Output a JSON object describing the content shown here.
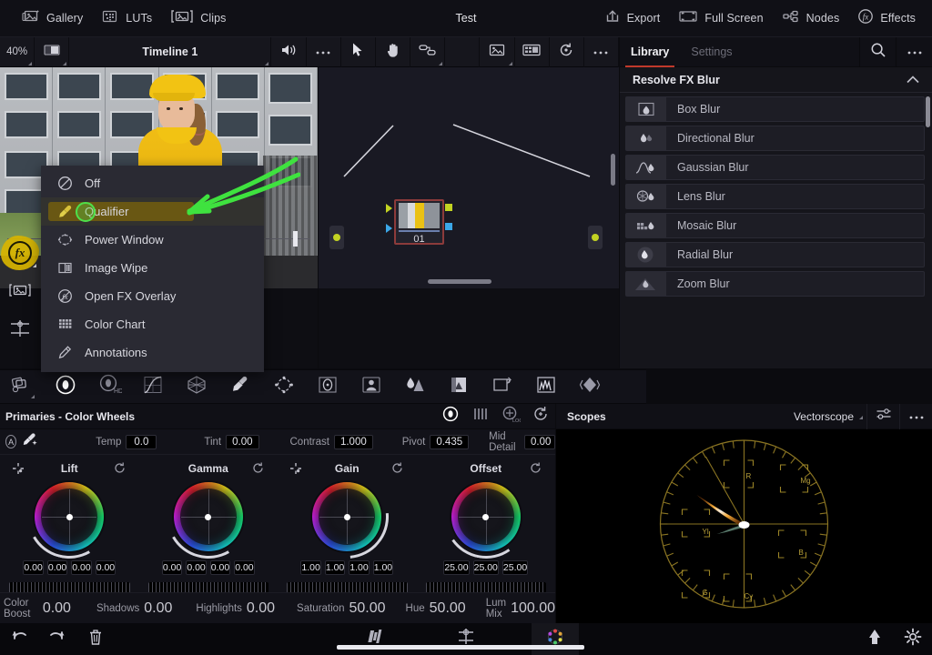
{
  "topbar": {
    "left_items": [
      {
        "label": "Gallery",
        "icon": "gallery-icon"
      },
      {
        "label": "LUTs",
        "icon": "luts-icon"
      },
      {
        "label": "Clips",
        "icon": "clips-icon"
      }
    ],
    "title": "Test",
    "right_items": [
      {
        "label": "Export",
        "icon": "export-icon"
      },
      {
        "label": "Full Screen",
        "icon": "fullscreen-icon"
      },
      {
        "label": "Nodes",
        "icon": "nodes-icon"
      },
      {
        "label": "Effects",
        "icon": "fx-icon"
      }
    ]
  },
  "viewer_bar": {
    "zoom": "40%",
    "timeline_label": "Timeline 1",
    "split_icon": "split-view-icon",
    "audio_icon": "speaker-icon",
    "more_icon": "more-options-icon",
    "tools": [
      "cursor-icon",
      "hand-icon",
      "node-link-icon",
      "image-icon",
      "grid-image-icon",
      "reset-history-icon",
      "more-options-icon"
    ]
  },
  "left_tools": [
    {
      "name": "openfx-overlay-toggle",
      "icon": "fx-icon",
      "state": "highlighted"
    },
    {
      "name": "image-wipe-tool",
      "icon": "image-wipe-icon"
    },
    {
      "name": "split-screen-tool",
      "icon": "split-screen-icon"
    }
  ],
  "context_menu": {
    "items": [
      {
        "label": "Off",
        "icon": "off-icon",
        "selected": false
      },
      {
        "label": "Qualifier",
        "icon": "eyedropper-icon",
        "selected": true
      },
      {
        "label": "Power Window",
        "icon": "power-window-icon",
        "selected": false
      },
      {
        "label": "Image Wipe",
        "icon": "image-wipe-icon",
        "selected": false
      },
      {
        "label": "Open FX Overlay",
        "icon": "fx-icon",
        "selected": false
      },
      {
        "label": "Color Chart",
        "icon": "color-chart-icon",
        "selected": false
      },
      {
        "label": "Annotations",
        "icon": "annotations-icon",
        "selected": false
      }
    ],
    "highlight_color": "#6d5a12",
    "annotation_color": "#4ee04a"
  },
  "node_editor": {
    "node_label": "01",
    "input_port": "source-node",
    "output_port": "output-node"
  },
  "effects_panel": {
    "tabs": [
      {
        "label": "Library",
        "active": true
      },
      {
        "label": "Settings",
        "active": false
      }
    ],
    "search_icon": "search-icon",
    "more_icon": "more-options-icon",
    "category": "Resolve FX Blur",
    "collapse_icon": "chevron-up-icon",
    "items": [
      {
        "label": "Box Blur",
        "icon": "box-blur-icon"
      },
      {
        "label": "Directional Blur",
        "icon": "directional-blur-icon"
      },
      {
        "label": "Gaussian Blur",
        "icon": "gaussian-blur-icon"
      },
      {
        "label": "Lens Blur",
        "icon": "lens-blur-icon"
      },
      {
        "label": "Mosaic Blur",
        "icon": "mosaic-blur-icon"
      },
      {
        "label": "Radial Blur",
        "icon": "radial-blur-icon"
      },
      {
        "label": "Zoom Blur",
        "icon": "zoom-blur-icon"
      }
    ]
  },
  "color_toolbar": {
    "buttons": [
      "clips-icon",
      "color-wheels-icon",
      "hdr-wheels-icon",
      "curves-icon",
      "color-warper-icon",
      "qualifier-icon",
      "power-window-icon",
      "tracker-icon",
      "magic-mask-icon",
      "blur-icon",
      "key-icon",
      "sizing-icon",
      "scopes-icon",
      "stills-icon"
    ]
  },
  "primaries": {
    "title": "Primaries - Color Wheels",
    "head_tools": [
      "primaries-wheels-icon",
      "primaries-bars-icon",
      "log-wheels-icon",
      "reset-icon"
    ],
    "auto_balance_label": "A",
    "picker_icon": "auto-picker-icon",
    "params": [
      {
        "label": "Temp",
        "value": "0.0",
        "bar": "temp"
      },
      {
        "label": "Tint",
        "value": "0.00",
        "bar": "tint"
      },
      {
        "label": "Contrast",
        "value": "1.000",
        "bar": "gray"
      },
      {
        "label": "Pivot",
        "value": "0.435",
        "bar": "gray"
      },
      {
        "label": "Mid Detail",
        "value": "0.00",
        "bar": "gray"
      }
    ],
    "wheels": [
      {
        "name": "Lift",
        "values": [
          "0.00",
          "0.00",
          "0.00",
          "0.00"
        ],
        "channels": [
          "white",
          "red",
          "green",
          "blue"
        ]
      },
      {
        "name": "Gamma",
        "values": [
          "0.00",
          "0.00",
          "0.00",
          "0.00"
        ],
        "channels": [
          "white",
          "red",
          "green",
          "blue"
        ]
      },
      {
        "name": "Gain",
        "values": [
          "1.00",
          "1.00",
          "1.00",
          "1.00"
        ],
        "channels": [
          "white",
          "red",
          "green",
          "blue"
        ]
      },
      {
        "name": "Offset",
        "values": [
          "25.00",
          "25.00",
          "25.00"
        ],
        "channels": [
          "red",
          "green",
          "blue"
        ]
      }
    ],
    "bottom_params": [
      {
        "label": "Color Boost",
        "value": "0.00",
        "bar": "rainbow"
      },
      {
        "label": "Shadows",
        "value": "0.00",
        "bar": "dark"
      },
      {
        "label": "Highlights",
        "value": "0.00",
        "bar": "white"
      },
      {
        "label": "Saturation",
        "value": "50.00",
        "bar": "rainbow"
      },
      {
        "label": "Hue",
        "value": "50.00",
        "bar": "rainbow"
      },
      {
        "label": "Lum Mix",
        "value": "100.00",
        "bar": "lummix"
      }
    ]
  },
  "scopes": {
    "title": "Scopes",
    "selected": "Vectorscope",
    "settings_icon": "sliders-icon",
    "more_icon": "more-options-icon",
    "targets": [
      "R",
      "Mg",
      "B",
      "Cy",
      "G",
      "Yl"
    ]
  },
  "bottom_bar": {
    "left": [
      "undo-icon",
      "redo-icon",
      "delete-icon"
    ],
    "center": [
      "timeline-page-icon",
      "clips-page-icon",
      "color-page-icon"
    ],
    "right": [
      "home-icon",
      "settings-icon"
    ]
  }
}
